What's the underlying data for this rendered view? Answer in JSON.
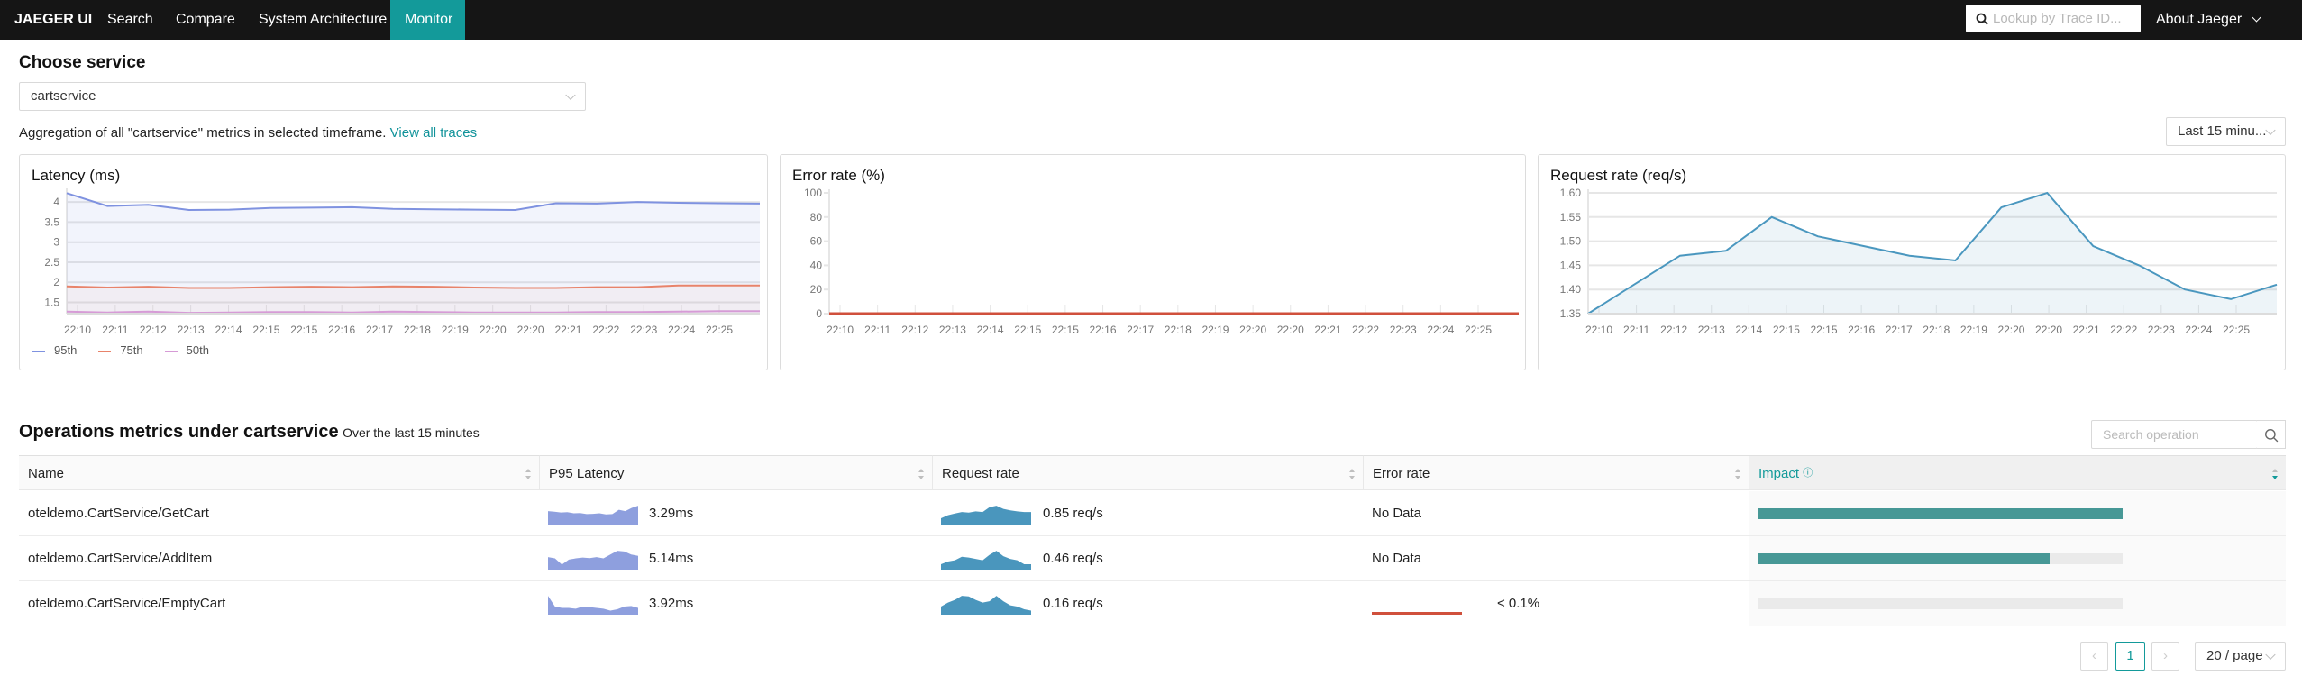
{
  "nav": {
    "brand": "JAEGER UI",
    "items": [
      "Search",
      "Compare",
      "System Architecture",
      "Monitor"
    ],
    "active": "Monitor",
    "search_placeholder": "Lookup by Trace ID...",
    "about": "About Jaeger"
  },
  "service": {
    "heading": "Choose service",
    "selected": "cartservice",
    "aggregation_text": "Aggregation of all \"cartservice\" metrics in selected timeframe.",
    "view_all_traces": "View all traces",
    "timeframe": "Last 15 minu..."
  },
  "colors": {
    "accent": "#139a9a",
    "p95": "#7f92e0",
    "p75": "#e8836a",
    "p50": "#d69bd6",
    "error": "#d0503c",
    "request": "#4a97bf",
    "impact": "#479896"
  },
  "chart_data": [
    {
      "type": "area",
      "title": "Latency (ms)",
      "ylim": [
        1.22,
        4.25
      ],
      "yticks": [
        1.5,
        2,
        2.5,
        3,
        3.5,
        4
      ],
      "xticks": [
        "22:10",
        "22:11",
        "22:12",
        "22:13",
        "22:14",
        "22:15",
        "22:15",
        "22:16",
        "22:17",
        "22:18",
        "22:19",
        "22:20",
        "22:20",
        "22:21",
        "22:22",
        "22:23",
        "22:24",
        "22:25"
      ],
      "legend": "bottom-left",
      "grid": true,
      "series": [
        {
          "name": "95th",
          "color": "#7f92e0",
          "values": [
            4.22,
            3.9,
            3.93,
            3.8,
            3.81,
            3.85,
            3.86,
            3.87,
            3.83,
            3.82,
            3.81,
            3.8,
            3.97,
            3.96,
            4.0,
            3.98,
            3.97,
            3.96
          ]
        },
        {
          "name": "75th",
          "color": "#e8836a",
          "values": [
            1.9,
            1.87,
            1.89,
            1.86,
            1.86,
            1.88,
            1.89,
            1.88,
            1.9,
            1.89,
            1.87,
            1.86,
            1.86,
            1.88,
            1.88,
            1.92,
            1.92,
            1.92
          ]
        },
        {
          "name": "50th",
          "color": "#d69bd6",
          "values": [
            1.27,
            1.25,
            1.27,
            1.24,
            1.25,
            1.26,
            1.26,
            1.25,
            1.27,
            1.26,
            1.25,
            1.25,
            1.25,
            1.26,
            1.26,
            1.27,
            1.28,
            1.28
          ]
        }
      ]
    },
    {
      "type": "line",
      "title": "Error rate (%)",
      "ylim": [
        0,
        100
      ],
      "yticks": [
        0,
        20,
        40,
        60,
        80,
        100
      ],
      "xticks": [
        "22:10",
        "22:11",
        "22:12",
        "22:13",
        "22:14",
        "22:15",
        "22:15",
        "22:16",
        "22:17",
        "22:18",
        "22:19",
        "22:20",
        "22:20",
        "22:21",
        "22:22",
        "22:23",
        "22:24",
        "22:25"
      ],
      "grid": false,
      "series": [
        {
          "color": "#d0503c",
          "values": [
            0,
            0,
            0,
            0,
            0,
            0,
            0,
            0,
            0,
            0,
            0,
            0,
            0,
            0,
            0,
            0,
            0,
            0
          ]
        }
      ]
    },
    {
      "type": "area",
      "title": "Request rate (req/s)",
      "ylim": [
        1.35,
        1.6
      ],
      "yticks": [
        "1.35",
        "1.40",
        "1.45",
        "1.50",
        "1.55",
        "1.60"
      ],
      "xticks": [
        "22:10",
        "22:11",
        "22:12",
        "22:13",
        "22:14",
        "22:15",
        "22:15",
        "22:16",
        "22:17",
        "22:18",
        "22:19",
        "22:20",
        "22:20",
        "22:21",
        "22:22",
        "22:23",
        "22:24",
        "22:25"
      ],
      "grid": true,
      "series": [
        {
          "color": "#4a97bf",
          "values": [
            1.35,
            1.41,
            1.47,
            1.48,
            1.55,
            1.51,
            1.49,
            1.47,
            1.46,
            1.57,
            1.6,
            1.49,
            1.45,
            1.4,
            1.38,
            1.41
          ]
        }
      ]
    }
  ],
  "operations": {
    "title": "Operations metrics under cartservice",
    "subtitle": "Over the last 15 minutes",
    "search_placeholder": "Search operation",
    "columns": [
      "Name",
      "P95 Latency",
      "Request rate",
      "Error rate",
      "Impact"
    ],
    "sorted_column": "Impact",
    "rows": [
      {
        "name": "oteldemo.CartService/GetCart",
        "latency": "3.29ms",
        "latency_spark": [
          5,
          4.8,
          4.5,
          4.6,
          4.2,
          4.3,
          3.9,
          4,
          4.2,
          3.8,
          3.9,
          5.5,
          5,
          6.2,
          7
        ],
        "rate": "0.85 req/s",
        "rate_spark": [
          2,
          3,
          3.5,
          4,
          3.8,
          4.2,
          4,
          5.5,
          6,
          5,
          4.5,
          4.2,
          4,
          4
        ],
        "error": "No Data",
        "error_spark": null,
        "impact": 1.0
      },
      {
        "name": "oteldemo.CartService/AddItem",
        "latency": "5.14ms",
        "latency_spark": [
          5,
          4.5,
          2,
          4,
          4.5,
          4.8,
          4.6,
          5,
          4.5,
          6,
          7.5,
          7.2,
          6,
          5.5
        ],
        "rate": "0.46 req/s",
        "rate_spark": [
          2,
          3,
          3.5,
          4.8,
          4.5,
          4,
          3.5,
          5.5,
          7,
          5,
          4,
          3.5,
          2,
          2
        ],
        "error": "No Data",
        "error_spark": null,
        "impact": 0.8
      },
      {
        "name": "oteldemo.CartService/EmptyCart",
        "latency": "3.92ms",
        "latency_spark": [
          7,
          3,
          2.5,
          2.5,
          2.2,
          3,
          2.8,
          2.5,
          2.2,
          1.5,
          2,
          3,
          3.2,
          2.5
        ],
        "rate": "0.16 req/s",
        "rate_spark": [
          3,
          4.5,
          5.5,
          7,
          6.8,
          5.5,
          4.5,
          5,
          7,
          5,
          3.5,
          3,
          2,
          1.5
        ],
        "error": "< 0.1%",
        "error_spark": [
          0,
          0,
          0,
          0,
          0
        ],
        "impact": 0.0
      }
    ]
  },
  "pagination": {
    "current": "1",
    "page_size": "20 / page"
  }
}
